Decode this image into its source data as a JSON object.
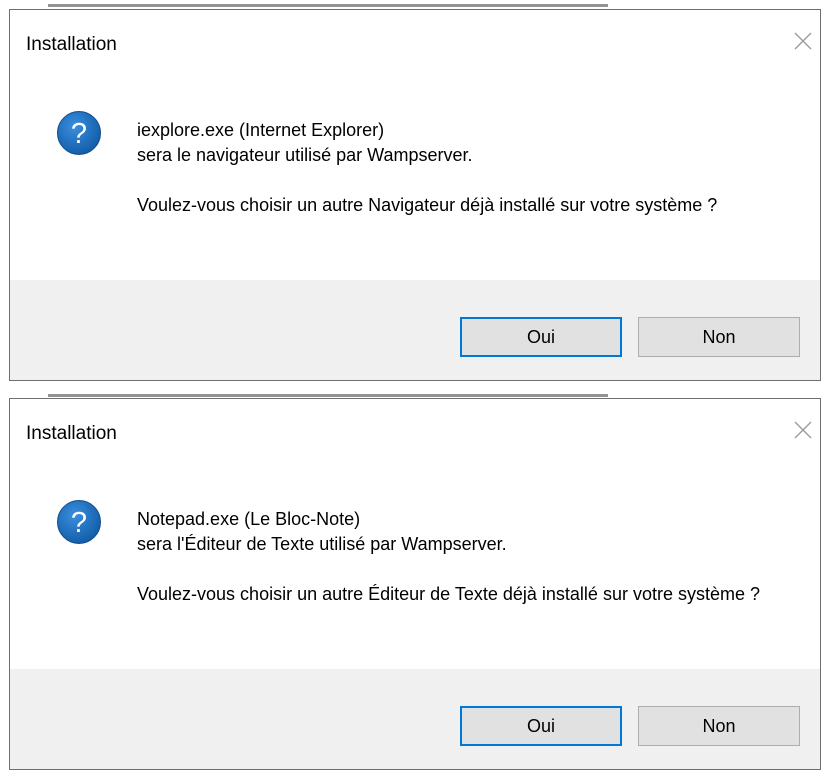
{
  "dialogs": [
    {
      "title": "Installation",
      "message_line1": "iexplore.exe (Internet Explorer)",
      "message_line2": "sera le navigateur utilisé par Wampserver.",
      "question": "Voulez-vous choisir un autre Navigateur déjà installé sur votre système ?",
      "yes_label": "Oui",
      "no_label": "Non"
    },
    {
      "title": "Installation",
      "message_line1": "Notepad.exe (Le Bloc-Note)",
      "message_line2": "sera l'Éditeur de Texte utilisé par Wampserver.",
      "question": "Voulez-vous choisir un autre Éditeur de Texte déjà installé sur votre système ?",
      "yes_label": "Oui",
      "no_label": "Non"
    }
  ],
  "colors": {
    "accent": "#0078d7",
    "icon_blue": "#1f6fc6",
    "footer_bg": "#f0f0f0",
    "button_bg": "#e1e1e1"
  },
  "icons": {
    "title_close": "close-icon",
    "dialog_icon": "question-icon"
  }
}
